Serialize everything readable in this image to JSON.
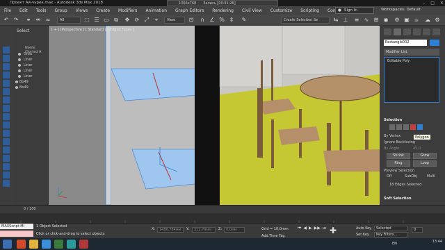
{
  "titlebar": {
    "title": "Проект Ай-чурек.max - Autodesk 3ds Max 2018",
    "resolution": "1366x768",
    "recording": "Запись [00:31:26]"
  },
  "menus": [
    "File",
    "Edit",
    "Tools",
    "Group",
    "Views",
    "Create",
    "Modifiers",
    "Animation",
    "Graph Editors",
    "Rendering",
    "Civil View",
    "Customize",
    "Scripting",
    "Content"
  ],
  "signin": "Sign In",
  "workspaces": {
    "label": "Workspaces:",
    "value": "Default"
  },
  "toolbar": {
    "filter": "All",
    "view": "View",
    "selection_set": "Create Selection Se"
  },
  "scene": {
    "header": "Select",
    "sorted_label": "Name (Sorted A",
    "rows": [
      "Grou",
      "Liner",
      "Liner",
      "Liner",
      "Liner",
      "Bo49",
      "Bo49"
    ]
  },
  "viewport": {
    "label": "[ + ] [Perspective ] [ Standard ] [ Edged Faces ]"
  },
  "rightpanel": {
    "object_name": "Rectangle002",
    "modifier_list": "Modifier List",
    "stack_item": "Editable Poly",
    "selection_title": "Selection",
    "by_vertex": "By Vertex",
    "ignore_backfacing": "Ignore Backfacing",
    "by_angle": "By Angle:",
    "angle_value": "45,0",
    "shrink": "Shrink",
    "grow": "Grow",
    "ring": "Ring",
    "loop": "Loop",
    "preview_selection": "Preview Selection",
    "preview_off": "Off",
    "preview_subobj": "SubObj",
    "preview_multi": "Multi",
    "edges_selected": "18 Edges Selected",
    "soft_selection": "Soft Selection",
    "tooltip": "Polygon"
  },
  "timeslider": {
    "label": "0 / 100"
  },
  "status": {
    "maxscript": "MAXScript Mi",
    "selected": "1 Object Selected",
    "hint": "Click or click-and-drag to select objects",
    "x_label": "X:",
    "x_value": "1486,784мм",
    "y_label": "Y:",
    "y_value": "312,79мм",
    "z_label": "Z:",
    "z_value": "0,0мм",
    "grid": "Grid = 10,0mm",
    "add_time_tag": "Add Time Tag",
    "auto_key": "Auto Key",
    "selected_dd": "Selected",
    "set_key": "Set Key",
    "key_filters": "Key Filters...",
    "frame": "0"
  },
  "taskbar": {
    "lang": "EN",
    "time": "13:44",
    "date": ""
  },
  "colors": {
    "accent": "#2e7fd6",
    "floor": "#c8cc32",
    "glass": "#9fc6ee"
  }
}
